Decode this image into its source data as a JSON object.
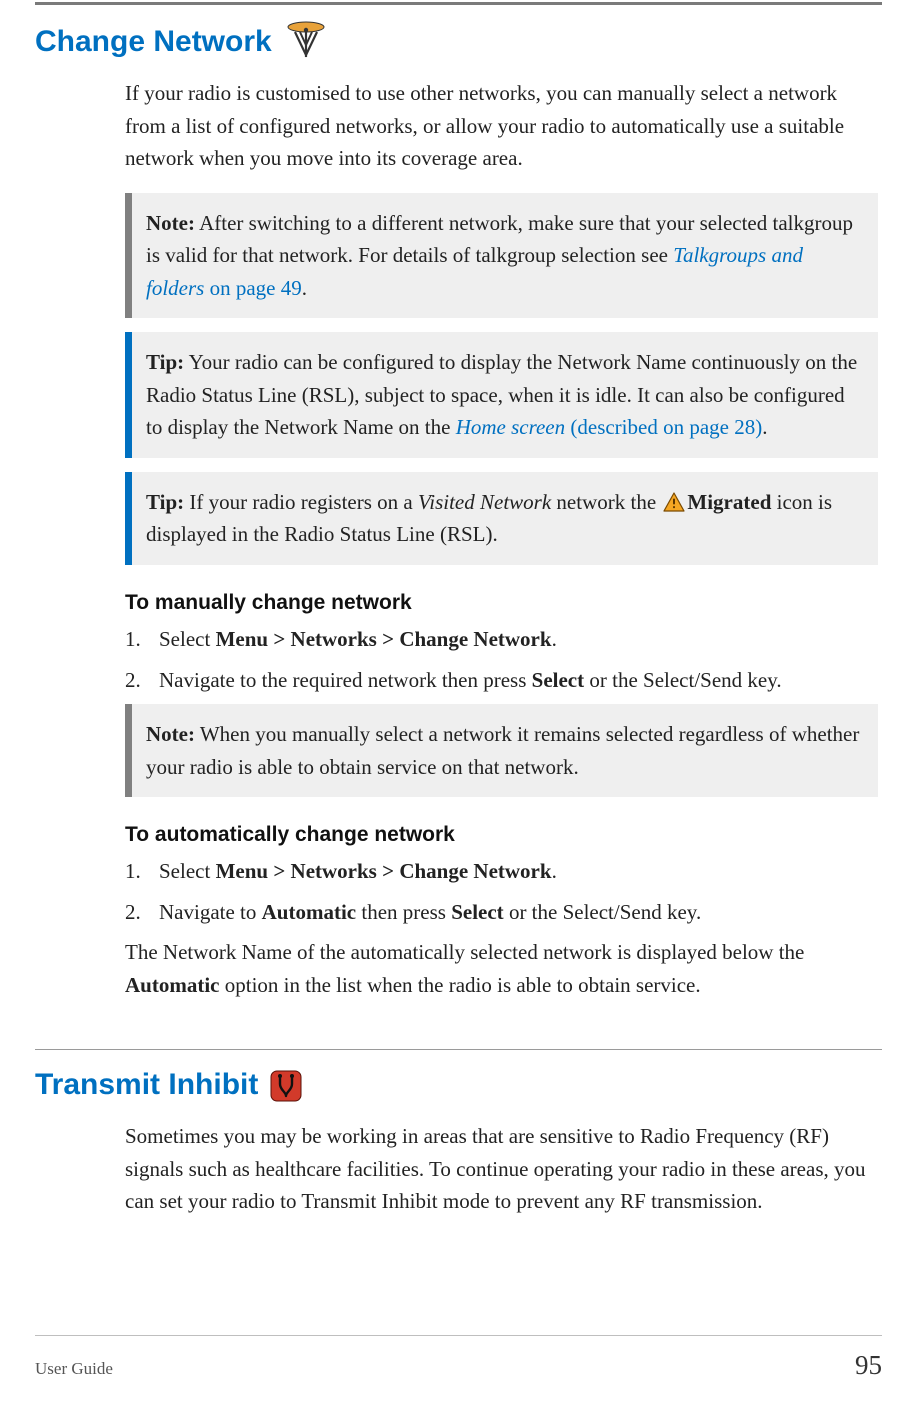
{
  "section1": {
    "title": "Change Network",
    "intro": "If your radio is customised to use other networks, you can manually select a network from a list of configured networks, or allow your radio to automatically use a suitable network when you move into its coverage area.",
    "note1": {
      "label": "Note:",
      "t1": "  After switching to a different network, make sure that your selected talkgroup is valid for that network. For details of talkgroup selection see ",
      "link": "Talkgroups and folders",
      "link_rest": " on page 49",
      "tail": "."
    },
    "tip1": {
      "label": "Tip:",
      "t1": "  Your radio can be configured to display the Network Name continuously on the Radio Status Line (RSL), subject to space, when it is idle. It can also be configured to display the Network Name on the ",
      "link": "Home screen",
      "link_rest": " (described on page 28)",
      "tail": "."
    },
    "tip2": {
      "label": "Tip:",
      "t1": "  If your radio registers on a ",
      "visited": "Visited Network",
      "t2": " network the ",
      "migrated": "Migrated",
      "t3": " icon is displayed in the Radio Status Line (RSL)."
    },
    "manual": {
      "heading": "To manually change network",
      "steps": {
        "s1_a": "Select ",
        "s1_b": "Menu > Networks > Change Network",
        "s1_c": ".",
        "s2_a": "Navigate to the required network then press ",
        "s2_b": "Select",
        "s2_c": " or the Select/Send key."
      },
      "note": {
        "label": "Note:",
        "text": "  When you manually select a network it remains selected regardless of whether your radio is able to obtain service on that network."
      }
    },
    "auto": {
      "heading": "To automatically change network",
      "steps": {
        "s1_a": "Select ",
        "s1_b": "Menu > Networks > Change Network",
        "s1_c": ".",
        "s2_a": "Navigate to ",
        "s2_b": "Automatic",
        "s2_c": " then press ",
        "s2_d": "Select",
        "s2_e": " or the Select/Send key."
      },
      "outro_a": "The Network Name of the automatically selected network is displayed below the ",
      "outro_b": "Automatic",
      "outro_c": " option in the list when the radio is able to obtain service."
    }
  },
  "section2": {
    "title": "Transmit Inhibit",
    "intro": "Sometimes you may be working in areas that are sensitive to Radio Frequency (RF) signals such as healthcare facilities. To continue operating your radio in these areas, you can set your radio to Transmit Inhibit mode to prevent any RF transmission."
  },
  "footer": {
    "doc": "User Guide",
    "page": "95"
  }
}
